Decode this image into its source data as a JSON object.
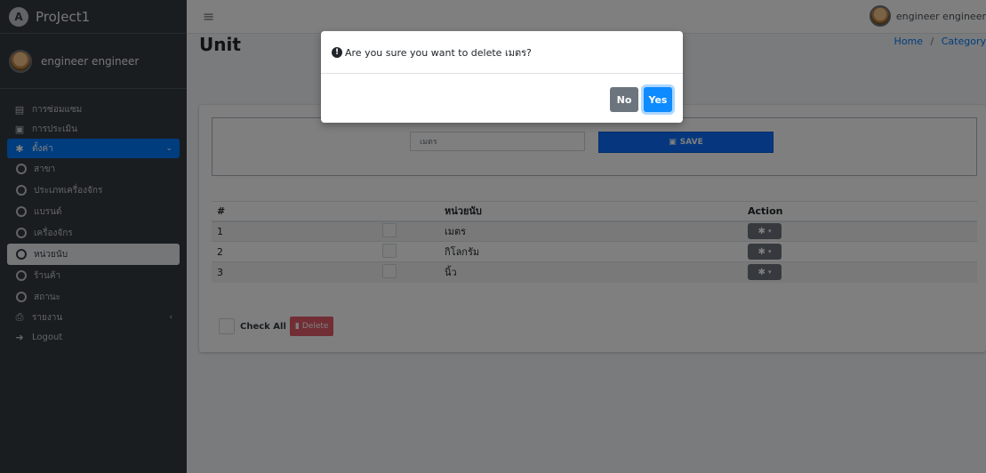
{
  "brand": {
    "name": "ProJect1",
    "logo_letter": "A"
  },
  "user": {
    "name": "engineer engineer"
  },
  "sidebar": {
    "items": [
      {
        "label": "การซ่อมแซม",
        "icon": "clipboard-icon"
      },
      {
        "label": "การประเมิน",
        "icon": "clipboard-check-icon"
      },
      {
        "label": "ตั้งค่า",
        "icon": "gear-icon",
        "active": true
      },
      {
        "label": "รายงาน",
        "icon": "file-pdf-icon",
        "chevron": "‹"
      },
      {
        "label": "Logout",
        "icon": "sign-out-icon"
      }
    ],
    "sub_items": [
      {
        "label": "สาขา"
      },
      {
        "label": "ประเภทเครื่องจักร"
      },
      {
        "label": "แบรนด์"
      },
      {
        "label": "เครื่องจักร"
      },
      {
        "label": "หน่วยนับ",
        "selected": true
      },
      {
        "label": "ร้านค้า"
      },
      {
        "label": "สถานะ"
      }
    ]
  },
  "header": {
    "title": "Unit",
    "breadcrumb": {
      "home": "Home",
      "separator": "/",
      "current": "Category"
    }
  },
  "form": {
    "unit_value": "เมตร",
    "save_label": "SAVE"
  },
  "table": {
    "columns": [
      "#",
      "หน่วยนับ",
      "Action"
    ],
    "rows": [
      {
        "num": "1",
        "unit": "เมตร"
      },
      {
        "num": "2",
        "unit": "กิโลกรัม"
      },
      {
        "num": "3",
        "unit": "นิ้ว"
      }
    ]
  },
  "bulk": {
    "check_all_label": "Check All",
    "delete_label": "Delete"
  },
  "modal": {
    "message": "Are you sure you want to delete เมตร?",
    "no_label": "No",
    "yes_label": "Yes"
  },
  "colors": {
    "sidebar_bg": "#343a40",
    "accent": "#007bff",
    "save_button": "#0d6efd",
    "delete_button": "#e35d6a",
    "secondary": "#6c757d"
  }
}
